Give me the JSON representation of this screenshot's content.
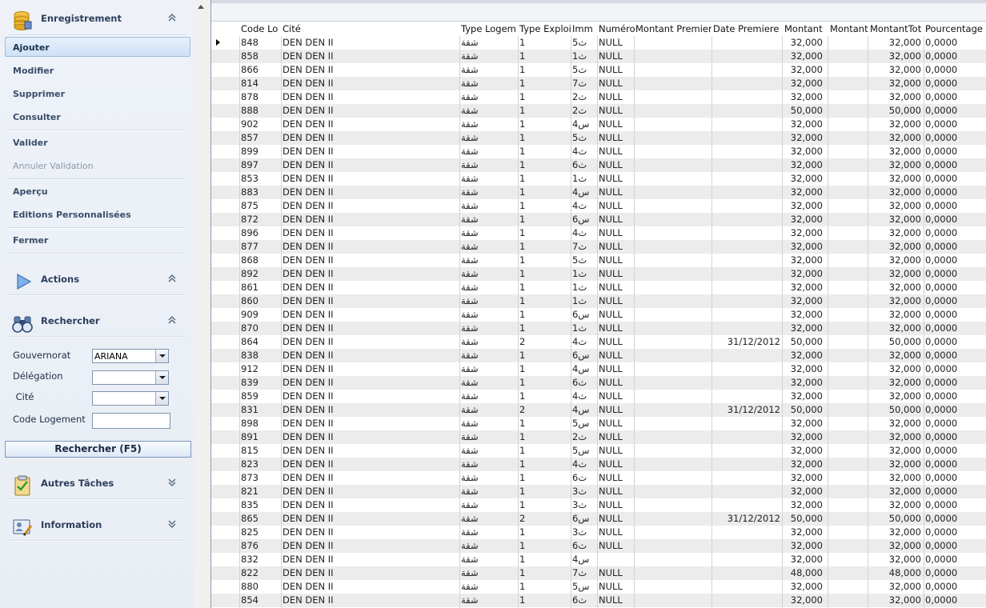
{
  "sidebar": {
    "enregistrement": {
      "title": "Enregistrement",
      "icon": "database-icon",
      "items": {
        "ajouter": "Ajouter",
        "modifier": "Modifier",
        "supprimer": "Supprimer",
        "consulter": "Consulter",
        "valider": "Valider",
        "annuler_validation": "Annuler Validation",
        "apercu": "Aperçu",
        "editions": "Editions Personnalisées",
        "fermer": "Fermer"
      }
    },
    "actions": {
      "title": "Actions",
      "icon": "play-triangle-icon"
    },
    "rechercher": {
      "title": "Rechercher",
      "icon": "binoculars-icon",
      "gouvernorat_label": "Gouvernorat",
      "gouvernorat_value": "ARIANA",
      "delegation_label": "Délégation",
      "delegation_value": "",
      "cite_label": " Cité",
      "cite_value": "",
      "code_logement_label": "Code Logement",
      "code_logement_value": "",
      "button": "Rechercher (F5)"
    },
    "autres_taches": {
      "title": "Autres Tâches",
      "icon": "clipboard-check-icon"
    },
    "information": {
      "title": "Information",
      "icon": "user-card-edit-icon"
    }
  },
  "grid": {
    "columns": [
      "Code Lo",
      "Cité",
      "Type Logem",
      "Type Exploi",
      "Imm",
      "Numéro",
      "Montant Premier",
      "Date Premiere",
      "Montant",
      "Montant",
      "MontantTot",
      "Pourcentage"
    ],
    "rows": [
      [
        "848",
        "DEN DEN II",
        "شقة",
        "1",
        "ث5",
        "NULL",
        "",
        "",
        "32,000",
        "",
        "32,000",
        "0,0000"
      ],
      [
        "858",
        "DEN DEN II",
        "شقة",
        "1",
        "ث1",
        "NULL",
        "",
        "",
        "32,000",
        "",
        "32,000",
        "0,0000"
      ],
      [
        "866",
        "DEN DEN II",
        "شقة",
        "1",
        "ث5",
        "NULL",
        "",
        "",
        "32,000",
        "",
        "32,000",
        "0,0000"
      ],
      [
        "814",
        "DEN DEN II",
        "شقة",
        "1",
        "ث7",
        "NULL",
        "",
        "",
        "32,000",
        "",
        "32,000",
        "0,0000"
      ],
      [
        "878",
        "DEN DEN II",
        "شقة",
        "1",
        "ث2",
        "NULL",
        "",
        "",
        "32,000",
        "",
        "32,000",
        "0,0000"
      ],
      [
        "888",
        "DEN DEN II",
        "شقة",
        "1",
        "ث2",
        "NULL",
        "",
        "",
        "50,000",
        "",
        "50,000",
        "0,0000"
      ],
      [
        "902",
        "DEN DEN II",
        "شقة",
        "1",
        "س4",
        "NULL",
        "",
        "",
        "32,000",
        "",
        "32,000",
        "0,0000"
      ],
      [
        "857",
        "DEN DEN II",
        "شقة",
        "1",
        "ث5",
        "NULL",
        "",
        "",
        "32,000",
        "",
        "32,000",
        "0,0000"
      ],
      [
        "899",
        "DEN DEN II",
        "شقة",
        "1",
        "ث4",
        "NULL",
        "",
        "",
        "32,000",
        "",
        "32,000",
        "0,0000"
      ],
      [
        "897",
        "DEN DEN II",
        "شقة",
        "1",
        "ث6",
        "NULL",
        "",
        "",
        "32,000",
        "",
        "32,000",
        "0,0000"
      ],
      [
        "853",
        "DEN DEN II",
        "شقة",
        "1",
        "ث1",
        "NULL",
        "",
        "",
        "32,000",
        "",
        "32,000",
        "0,0000"
      ],
      [
        "883",
        "DEN DEN II",
        "شقة",
        "1",
        "س4",
        "NULL",
        "",
        "",
        "32,000",
        "",
        "32,000",
        "0,0000"
      ],
      [
        "875",
        "DEN DEN II",
        "شقة",
        "1",
        "ث4",
        "NULL",
        "",
        "",
        "32,000",
        "",
        "32,000",
        "0,0000"
      ],
      [
        "872",
        "DEN DEN II",
        "شقة",
        "1",
        "س6",
        "NULL",
        "",
        "",
        "32,000",
        "",
        "32,000",
        "0,0000"
      ],
      [
        "896",
        "DEN DEN II",
        "شقة",
        "1",
        "ث4",
        "NULL",
        "",
        "",
        "32,000",
        "",
        "32,000",
        "0,0000"
      ],
      [
        "877",
        "DEN DEN II",
        "شقة",
        "1",
        "ث7",
        "NULL",
        "",
        "",
        "32,000",
        "",
        "32,000",
        "0,0000"
      ],
      [
        "868",
        "DEN DEN II",
        "شقة",
        "1",
        "ث5",
        "NULL",
        "",
        "",
        "32,000",
        "",
        "32,000",
        "0,0000"
      ],
      [
        "892",
        "DEN DEN II",
        "شقة",
        "1",
        "ث1",
        "NULL",
        "",
        "",
        "32,000",
        "",
        "32,000",
        "0,0000"
      ],
      [
        "861",
        "DEN DEN II",
        "شقة",
        "1",
        "ث1",
        "NULL",
        "",
        "",
        "32,000",
        "",
        "32,000",
        "0,0000"
      ],
      [
        "860",
        "DEN DEN II",
        "شقة",
        "1",
        "ث1",
        "NULL",
        "",
        "",
        "32,000",
        "",
        "32,000",
        "0,0000"
      ],
      [
        "909",
        "DEN DEN II",
        "شقة",
        "1",
        "س6",
        "NULL",
        "",
        "",
        "32,000",
        "",
        "32,000",
        "0,0000"
      ],
      [
        "870",
        "DEN DEN II",
        "شقة",
        "1",
        "ث1",
        "NULL",
        "",
        "",
        "32,000",
        "",
        "32,000",
        "0,0000"
      ],
      [
        "864",
        "DEN DEN II",
        "شقة",
        "2",
        "ث4",
        "NULL",
        "",
        "31/12/2012",
        "50,000",
        "",
        "50,000",
        "0,0000"
      ],
      [
        "838",
        "DEN DEN II",
        "شقة",
        "1",
        "س6",
        "NULL",
        "",
        "",
        "32,000",
        "",
        "32,000",
        "0,0000"
      ],
      [
        "912",
        "DEN DEN II",
        "شقة",
        "1",
        "س4",
        "NULL",
        "",
        "",
        "32,000",
        "",
        "32,000",
        "0,0000"
      ],
      [
        "839",
        "DEN DEN II",
        "شقة",
        "1",
        "ث6",
        "NULL",
        "",
        "",
        "32,000",
        "",
        "32,000",
        "0,0000"
      ],
      [
        "859",
        "DEN DEN II",
        "شقة",
        "1",
        "ث4",
        "NULL",
        "",
        "",
        "32,000",
        "",
        "32,000",
        "0,0000"
      ],
      [
        "831",
        "DEN DEN II",
        "شقة",
        "2",
        "س4",
        "NULL",
        "",
        "31/12/2012",
        "50,000",
        "",
        "50,000",
        "0,0000"
      ],
      [
        "898",
        "DEN DEN II",
        "شقة",
        "1",
        "س5",
        "NULL",
        "",
        "",
        "32,000",
        "",
        "32,000",
        "0,0000"
      ],
      [
        "891",
        "DEN DEN II",
        "شقة",
        "1",
        "ث2",
        "NULL",
        "",
        "",
        "32,000",
        "",
        "32,000",
        "0,0000"
      ],
      [
        "815",
        "DEN DEN II",
        "شقة",
        "1",
        "س5",
        "NULL",
        "",
        "",
        "32,000",
        "",
        "32,000",
        "0,0000"
      ],
      [
        "823",
        "DEN DEN II",
        "شقة",
        "1",
        "ث4",
        "NULL",
        "",
        "",
        "32,000",
        "",
        "32,000",
        "0,0000"
      ],
      [
        "873",
        "DEN DEN II",
        "شقة",
        "1",
        "ث6",
        "NULL",
        "",
        "",
        "32,000",
        "",
        "32,000",
        "0,0000"
      ],
      [
        "821",
        "DEN DEN II",
        "شقة",
        "1",
        "ث3",
        "NULL",
        "",
        "",
        "32,000",
        "",
        "32,000",
        "0,0000"
      ],
      [
        "835",
        "DEN DEN II",
        "شقة",
        "1",
        "ث3",
        "NULL",
        "",
        "",
        "32,000",
        "",
        "32,000",
        "0,0000"
      ],
      [
        "865",
        "DEN DEN II",
        "شقة",
        "2",
        "س6",
        "NULL",
        "",
        "31/12/2012",
        "50,000",
        "",
        "50,000",
        "0,0000"
      ],
      [
        "825",
        "DEN DEN II",
        "شقة",
        "1",
        "ث3",
        "NULL",
        "",
        "",
        "32,000",
        "",
        "32,000",
        "0,0000"
      ],
      [
        "876",
        "DEN DEN II",
        "شقة",
        "1",
        "ث6",
        "NULL",
        "",
        "",
        "32,000",
        "",
        "32,000",
        "0,0000"
      ],
      [
        "832",
        "DEN DEN II",
        "شقة",
        "1",
        "س4",
        "",
        "",
        "",
        "32,000",
        "",
        "32,000",
        "0,0000"
      ],
      [
        "822",
        "DEN DEN II",
        "شقة",
        "1",
        "ث7",
        "NULL",
        "",
        "",
        "48,000",
        "",
        "48,000",
        "0,0000"
      ],
      [
        "880",
        "DEN DEN II",
        "شقة",
        "1",
        "س5",
        "NULL",
        "",
        "",
        "32,000",
        "",
        "32,000",
        "0,0000"
      ],
      [
        "854",
        "DEN DEN II",
        "شقة",
        "1",
        "ث6",
        "NULL",
        "",
        "",
        "32,000",
        "",
        "32,000",
        "0,0000"
      ]
    ]
  },
  "colors": {
    "accent": "#cfe1f7",
    "sidebar_bg": "#e9eef5",
    "row_alt": "#ececec"
  }
}
